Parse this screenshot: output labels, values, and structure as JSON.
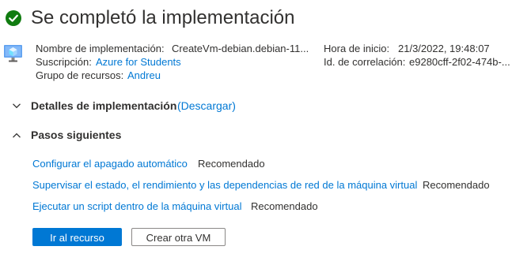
{
  "header": {
    "title": "Se completó la implementación",
    "status_icon": "check-circle-icon",
    "status_color": "#107c10"
  },
  "details": {
    "deployment_name_label": "Nombre de implementación:",
    "deployment_name_value": "CreateVm-debian.debian-11...",
    "subscription_label": "Suscripción:",
    "subscription_value": "Azure for Students",
    "resource_group_label": "Grupo de recursos:",
    "resource_group_value": "Andreu",
    "start_time_label": "Hora de inicio:",
    "start_time_value": "21/3/2022, 19:48:07",
    "correlation_id_label": "Id. de correlación:",
    "correlation_id_value": "e9280cff-2f02-474b-..."
  },
  "sections": {
    "deployment_details_label": "Detalles de implementación",
    "download_link": "(Descargar)",
    "next_steps_label": "Pasos siguientes"
  },
  "next_steps": [
    {
      "label": "Configurar el apagado automático",
      "badge": "Recomendado"
    },
    {
      "label": "Supervisar el estado, el rendimiento y las dependencias de red de la máquina virtual",
      "badge": "Recomendado"
    },
    {
      "label": "Ejecutar un script dentro de la máquina virtual",
      "badge": "Recomendado"
    }
  ],
  "actions": {
    "go_to_resource": "Ir al recurso",
    "create_another_vm": "Crear otra VM"
  },
  "colors": {
    "accent": "#0078d4",
    "text": "#323130"
  }
}
